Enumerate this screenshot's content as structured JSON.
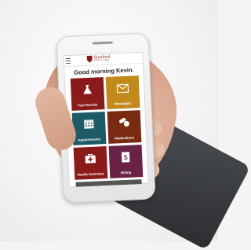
{
  "app": {
    "logo": {
      "name": "Stanford",
      "subtitle": "HEALTH CARE"
    },
    "greeting": "Good morning Kevin."
  },
  "tiles": [
    {
      "label": "Test Results",
      "icon": "flask-icon",
      "color": "#8a1b1b"
    },
    {
      "label": "Messages",
      "icon": "envelope-icon",
      "color": "#c28a1c"
    },
    {
      "label": "Appointments",
      "icon": "calendar-icon",
      "color": "#1f5b66"
    },
    {
      "label": "Medications",
      "icon": "pills-icon",
      "color": "#7a2a12"
    },
    {
      "label": "Health Summary",
      "icon": "first-aid-kit-icon",
      "color": "#8a1b1b"
    },
    {
      "label": "Billing",
      "icon": "dollar-bill-icon",
      "color": "#6a2346"
    }
  ],
  "colors": {
    "brand": "#8c1515",
    "background": "#f4f4f4"
  }
}
